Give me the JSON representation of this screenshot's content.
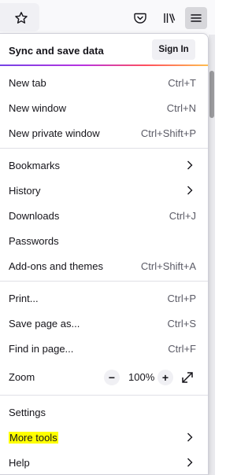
{
  "menu": {
    "sync_label": "Sync and save data",
    "sign_in_label": "Sign In",
    "items": [
      {
        "label": "New tab",
        "shortcut": "Ctrl+T"
      },
      {
        "label": "New window",
        "shortcut": "Ctrl+N"
      },
      {
        "label": "New private window",
        "shortcut": "Ctrl+Shift+P"
      },
      {
        "label": "Bookmarks"
      },
      {
        "label": "History"
      },
      {
        "label": "Downloads",
        "shortcut": "Ctrl+J"
      },
      {
        "label": "Passwords"
      },
      {
        "label": "Add-ons and themes",
        "shortcut": "Ctrl+Shift+A"
      },
      {
        "label": "Print...",
        "shortcut": "Ctrl+P"
      },
      {
        "label": "Save page as...",
        "shortcut": "Ctrl+S"
      },
      {
        "label": "Find in page...",
        "shortcut": "Ctrl+F"
      },
      {
        "label": "Zoom"
      },
      {
        "label": "Settings"
      },
      {
        "label": "More tools"
      },
      {
        "label": "Help"
      }
    ],
    "zoom": {
      "minus": "−",
      "value": "100%",
      "plus": "+"
    }
  },
  "icons": {
    "toolbar": [
      "star-icon",
      "pocket-icon",
      "library-icon",
      "hamburger-menu-icon"
    ],
    "submenu": "chevron-right-icon",
    "fullscreen": "fullscreen-icon"
  },
  "colors": {
    "highlight": "#ffff00",
    "sync_gradient": [
      "#7542e5",
      "#b833e1",
      "#ff4f5e",
      "#ffbd4f"
    ],
    "active_menu_button": "#d7d7db"
  }
}
